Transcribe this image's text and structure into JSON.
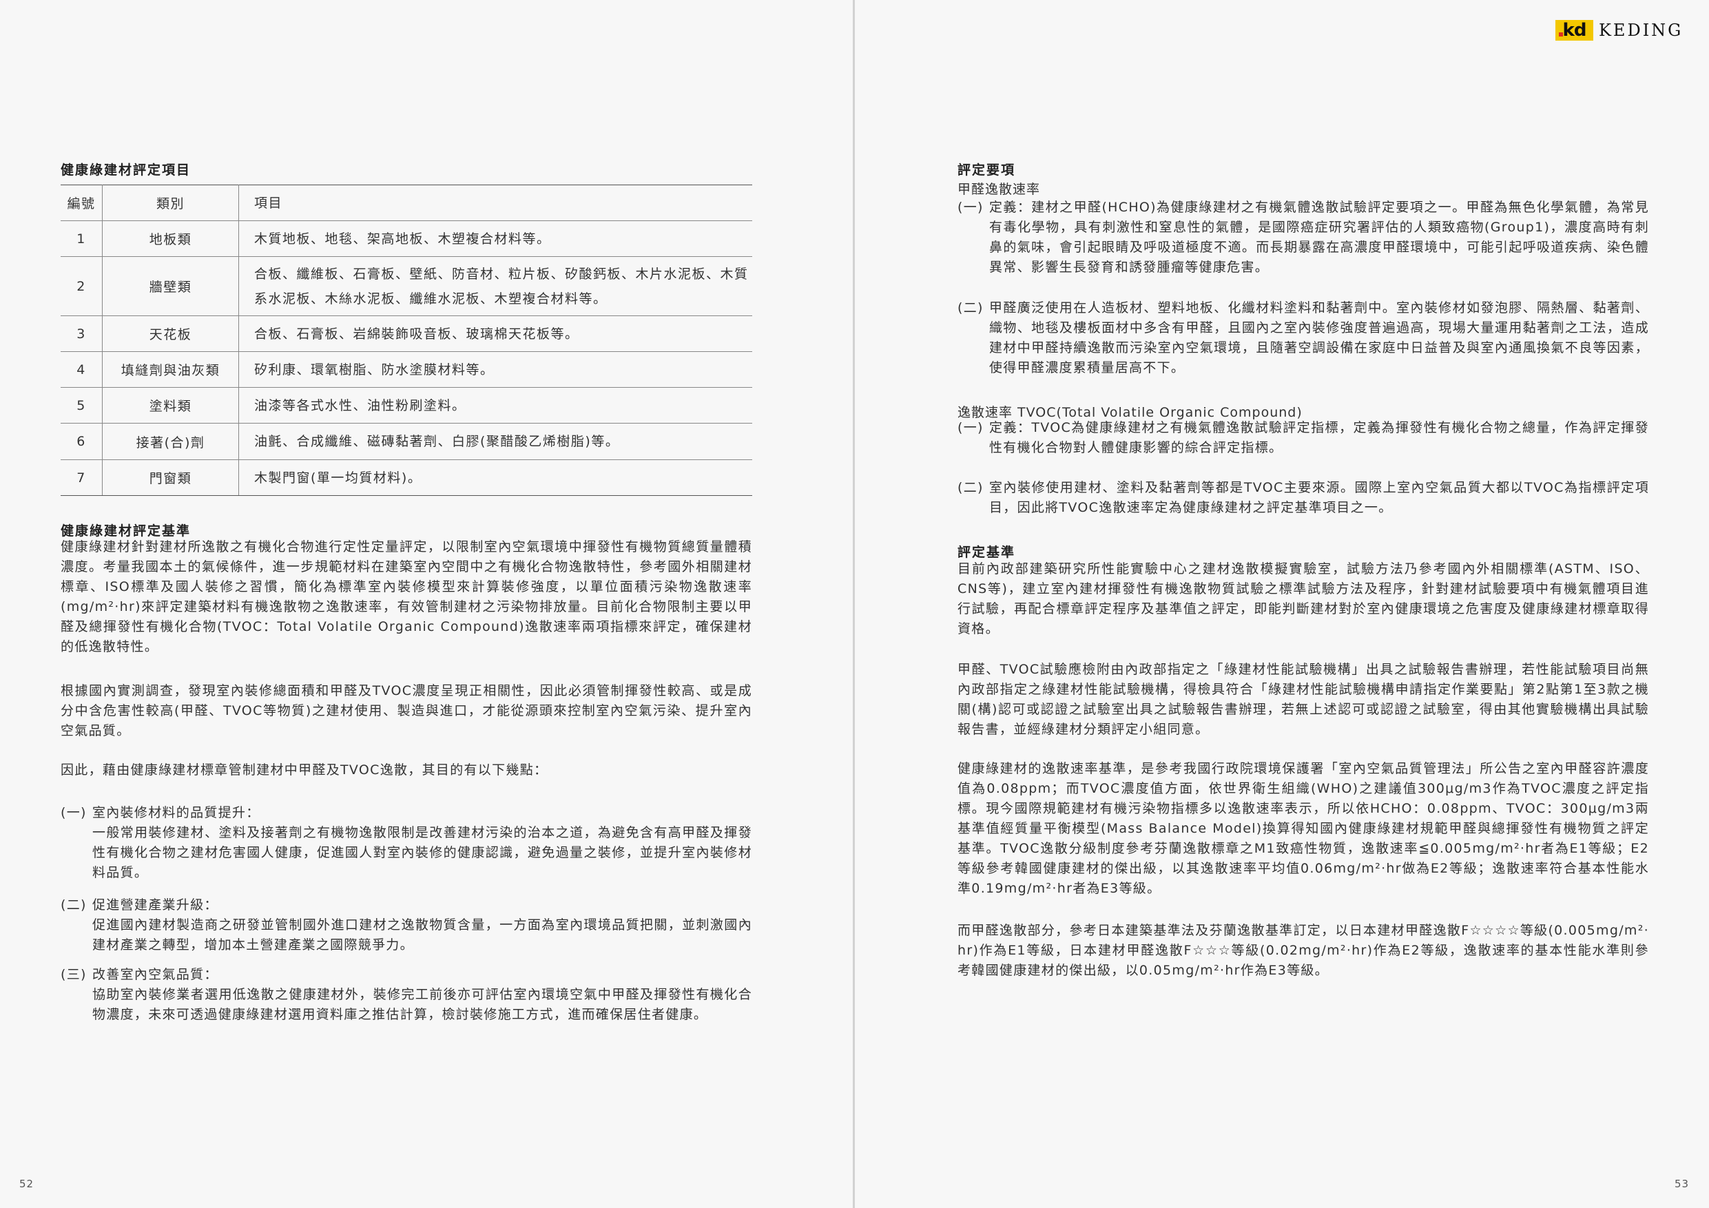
{
  "left": {
    "table_title": "健康綠建材評定項目",
    "table": {
      "headers": [
        "編號",
        "類別",
        "項目"
      ],
      "rows": [
        {
          "no": "1",
          "category": "地板類",
          "items": "木質地板、地毯、架高地板、木塑複合材料等。"
        },
        {
          "no": "2",
          "category": "牆壁類",
          "items": "合板、纖維板、石膏板、壁紙、防音材、粒片板、矽酸鈣板、木片水泥板、木質系水泥板、木絲水泥板、纖維水泥板、木塑複合材料等。"
        },
        {
          "no": "3",
          "category": "天花板",
          "items": "合板、石膏板、岩綿裝飾吸音板、玻璃棉天花板等。"
        },
        {
          "no": "4",
          "category": "填縫劑與油灰類",
          "items": "矽利康、環氧樹脂、防水塗膜材料等。"
        },
        {
          "no": "5",
          "category": "塗料類",
          "items": "油漆等各式水性、油性粉刷塗料。"
        },
        {
          "no": "6",
          "category": "接著(合)劑",
          "items": "油氈、合成纖維、磁磚黏著劑、白膠(聚醋酸乙烯樹脂)等。"
        },
        {
          "no": "7",
          "category": "門窗類",
          "items": "木製門窗(單一均質材料)。"
        }
      ]
    },
    "standard_title": "健康綠建材評定基準",
    "p1": "健康綠建材針對建材所逸散之有機化合物進行定性定量評定，以限制室內空氣環境中揮發性有機物質總質量體積濃度。考量我國本土的氣候條件，進一步規範材料在建築室內空間中之有機化合物逸散特性，參考國外相關建材標章、ISO標準及國人裝修之習慣，簡化為標準室內裝修模型來計算裝修強度，以單位面積污染物逸散速率(mg/m²‧hr)來評定建築材料有機逸散物之逸散速率，有效管制建材之污染物排放量。目前化合物限制主要以甲醛及總揮發性有機化合物(TVOC：Total Volatile Organic Compound)逸散速率兩項指標來評定，確保建材的低逸散特性。",
    "p2": "根據國內實測調查，發現室內裝修總面積和甲醛及TVOC濃度呈現正相關性，因此必須管制揮發性較高、或是成分中含危害性較高(甲醛、TVOC等物質)之建材使用、製造與進口，才能從源頭來控制室內空氣污染、提升室內空氣品質。",
    "p3": "因此，藉由健康綠建材標章管制建材中甲醛及TVOC逸散，其目的有以下幾點：",
    "points": [
      {
        "marker": "(一)",
        "title": "室內裝修材料的品質提升：",
        "text": "一般常用裝修建材、塗料及接著劑之有機物逸散限制是改善建材污染的治本之道，為避免含有高甲醛及揮發性有機化合物之建材危害國人健康，促進國人對室內裝修的健康認識，避免過量之裝修，並提升室內裝修材料品質。"
      },
      {
        "marker": "(二)",
        "title": "促進營建產業升級：",
        "text": "促進國內建材製造商之研發並管制國外進口建材之逸散物質含量，一方面為室內環境品質把關，並刺激國內建材產業之轉型，增加本土營建產業之國際競爭力。"
      },
      {
        "marker": "(三)",
        "title": "改善室內空氣品質：",
        "text": "協助室內裝修業者選用低逸散之健康建材外，裝修完工前後亦可評估室內環境空氣中甲醛及揮發性有機化合物濃度，未來可透過健康綠建材選用資料庫之推估計算，檢討裝修施工方式，進而確保居住者健康。"
      }
    ],
    "page_number": "52"
  },
  "right": {
    "brand": {
      "logo_text": "kd",
      "name": "KEDING",
      "color": "#f3c700"
    },
    "req_title": "評定要項",
    "hcho_title": "甲醛逸散速率",
    "hcho_items": [
      {
        "marker": "(一)",
        "text": "定義：建材之甲醛(HCHO)為健康綠建材之有機氣體逸散試驗評定要項之一。甲醛為無色化學氣體，為常見有毒化學物，具有刺激性和窒息性的氣體，是國際癌症研究署評估的人類致癌物(Group1)，濃度高時有刺鼻的氣味，會引起眼睛及呼吸道極度不適。而長期暴露在高濃度甲醛環境中，可能引起呼吸道疾病、染色體異常、影響生長發育和誘發腫瘤等健康危害。"
      },
      {
        "marker": "(二)",
        "text": "甲醛廣泛使用在人造板材、塑料地板、化纖材料塗料和黏著劑中。室內裝修材如發泡膠、隔熱層、黏著劑、織物、地毯及樓板面材中多含有甲醛，且國內之室內裝修強度普遍過高，現場大量運用黏著劑之工法，造成建材中甲醛持續逸散而污染室內空氣環境，且隨著空調設備在家庭中日益普及與室內通風換氣不良等因素，使得甲醛濃度累積量居高不下。"
      }
    ],
    "tvoc_title": "逸散速率 TVOC(Total Volatile Organic Compound)",
    "tvoc_items": [
      {
        "marker": "(一)",
        "text": "定義：TVOC為健康綠建材之有機氣體逸散試驗評定指標，定義為揮發性有機化合物之總量，作為評定揮發性有機化合物對人體健康影響的綜合評定指標。"
      },
      {
        "marker": "(二)",
        "text": "室內裝修使用建材、塗料及黏著劑等都是TVOC主要來源。國際上室內空氣品質大都以TVOC為指標評定項目，因此將TVOC逸散速率定為健康綠建材之評定基準項目之一。"
      }
    ],
    "basis_title": "評定基準",
    "basis_p1": "目前內政部建築研究所性能實驗中心之建材逸散模擬實驗室，試驗方法乃參考國內外相關標準(ASTM、ISO、CNS等)，建立室內建材揮發性有機逸散物質試驗之標準試驗方法及程序，針對建材試驗要項中有機氣體項目進行試驗，再配合標章評定程序及基準值之評定，即能判斷建材對於室內健康環境之危害度及健康綠建材標章取得資格。",
    "basis_p2": "甲醛、TVOC試驗應檢附由內政部指定之「綠建材性能試驗機構」出具之試驗報告書辦理，若性能試驗項目尚無內政部指定之綠建材性能試驗機構，得檢具符合「綠建材性能試驗機構申請指定作業要點」第2點第1至3款之機關(構)認可或認證之試驗室出具之試驗報告書辦理，若無上述認可或認證之試驗室，得由其他實驗機構出具試驗報告書，並經綠建材分類評定小組同意。",
    "basis_p3": "健康綠建材的逸散速率基準，是參考我國行政院環境保護署「室內空氣品質管理法」所公告之室內甲醛容許濃度值為0.08ppm；而TVOC濃度值方面，依世界衛生組織(WHO)之建議值300μg/m3作為TVOC濃度之評定指標。現今國際規範建材有機污染物指標多以逸散速率表示，所以依HCHO：0.08ppm、TVOC：300μg/m3兩基準值經質量平衡模型(Mass Balance Model)換算得知國內健康綠建材規範甲醛與總揮發性有機物質之評定基準。TVOC逸散分級制度參考芬蘭逸散標章之M1致癌性物質，逸散速率≦0.005mg/m²‧hr者為E1等級；E2等級參考韓國健康建材的傑出級，以其逸散速率平均值0.06mg/m²‧hr做為E2等級；逸散速率符合基本性能水準0.19mg/m²‧hr者為E3等級。",
    "basis_p4": "而甲醛逸散部分，參考日本建築基準法及芬蘭逸散基準訂定，以日本建材甲醛逸散F☆☆☆☆等級(0.005mg/m²‧hr)作為E1等級，日本建材甲醛逸散F☆☆☆等級(0.02mg/m²‧hr)作為E2等級，逸散速率的基本性能水準則參考韓國健康建材的傑出級，以0.05mg/m²‧hr作為E3等級。",
    "page_number": "53"
  }
}
